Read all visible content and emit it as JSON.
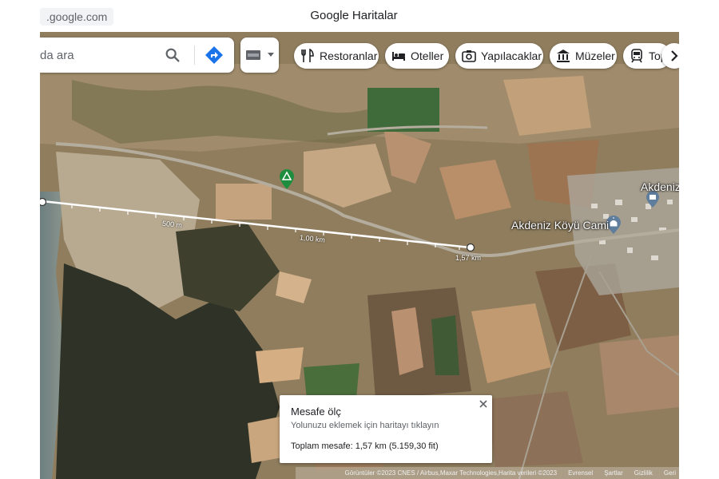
{
  "browser": {
    "url": ".google.com",
    "title": "Google Haritalar"
  },
  "search": {
    "value": "",
    "placeholder": "da ara",
    "search_icon": "search-icon",
    "directions_icon": "directions-icon"
  },
  "layers": {
    "icon": "layers-icon",
    "caret_icon": "caret-down-icon"
  },
  "chips": [
    {
      "label": "Restoranlar",
      "icon": "fork-knife-icon"
    },
    {
      "label": "Oteller",
      "icon": "bed-icon"
    },
    {
      "label": "Yapılacaklar",
      "icon": "camera-icon"
    },
    {
      "label": "Müzeler",
      "icon": "museum-icon"
    },
    {
      "label": "Top",
      "icon": "transit-icon"
    }
  ],
  "chips_more_icon": "chevron-right-icon",
  "map": {
    "place_labels": [
      {
        "text": "Akdeniz"
      },
      {
        "text": "Akdeniz Köyü Cami"
      }
    ],
    "distance_labels": [
      "500 m",
      "1,00 km",
      "1,57 km"
    ],
    "icons": [
      "campsite-marker-icon",
      "mosque-marker-icon",
      "place-marker-icon"
    ],
    "colors": {
      "measure_line": "#ffffff",
      "campsite_marker": "#1e8e3e",
      "place_marker": "#5f7d9c"
    }
  },
  "measure": {
    "title": "Mesafe ölç",
    "hint": "Yolunuzu eklemek için haritayı tıklayın",
    "total": "Toplam mesafe: 1,57 km (5.159,30 fit)",
    "close_icon": "close-icon"
  },
  "attribution": {
    "imagery": "Görüntüler ©2023 CNES / Airbus,Maxar Technologies,Harita verileri ©2023",
    "links": [
      "Evrensel",
      "Şartlar",
      "Gizlilik",
      "Geri"
    ]
  }
}
